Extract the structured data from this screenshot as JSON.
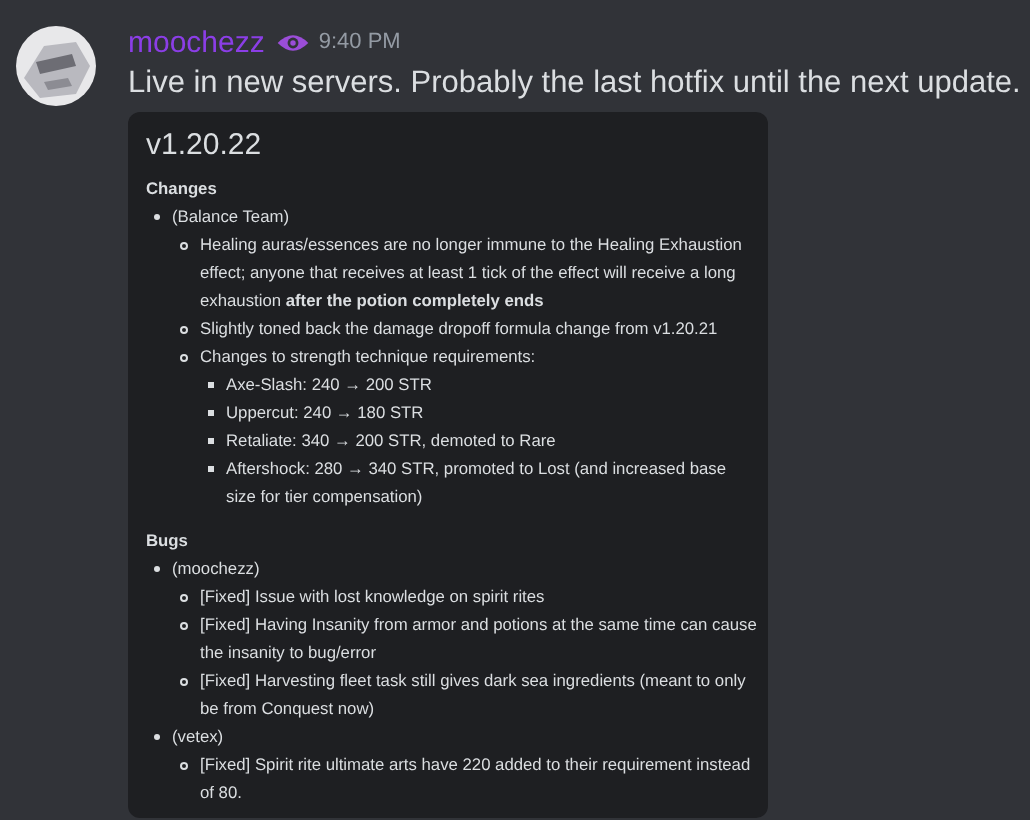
{
  "message": {
    "author": "moochezz",
    "time": "9:40 PM",
    "text": "Live in new servers. Probably the last hotfix until the next update."
  },
  "embed": {
    "title": "v1.20.22",
    "sections": [
      {
        "heading": "Changes",
        "items": [
          {
            "text": "(Balance Team)",
            "children": [
              {
                "text": "Healing auras/essences are no longer immune to the Healing Exhaustion effect; anyone that receives at least 1 tick of the effect will receive a long exhaustion **after the potion completely ends**"
              },
              {
                "text": "Slightly toned back the damage dropoff formula change from v1.20.21"
              },
              {
                "text": "Changes to strength technique requirements:",
                "children": [
                  {
                    "text": "Axe-Slash: 240 → 200 STR"
                  },
                  {
                    "text": "Uppercut: 240 → 180 STR"
                  },
                  {
                    "text": "Retaliate: 340 → 200 STR, demoted to Rare"
                  },
                  {
                    "text": "Aftershock: 280 → 340 STR, promoted to Lost (and increased base size for tier compensation)"
                  }
                ]
              }
            ]
          }
        ]
      },
      {
        "heading": "Bugs",
        "items": [
          {
            "text": "(moochezz)",
            "children": [
              {
                "text": "[Fixed] Issue with lost knowledge on spirit rites"
              },
              {
                "text": "[Fixed] Having Insanity from armor and potions at the same time can cause the insanity to bug/error"
              },
              {
                "text": "[Fixed] Harvesting fleet task still gives dark sea ingredients (meant to only be from Conquest now)"
              }
            ]
          },
          {
            "text": "(vetex)",
            "children": [
              {
                "text": "[Fixed] Spirit rite ultimate arts have 220 added to their requirement instead of 80."
              }
            ]
          }
        ]
      }
    ]
  }
}
